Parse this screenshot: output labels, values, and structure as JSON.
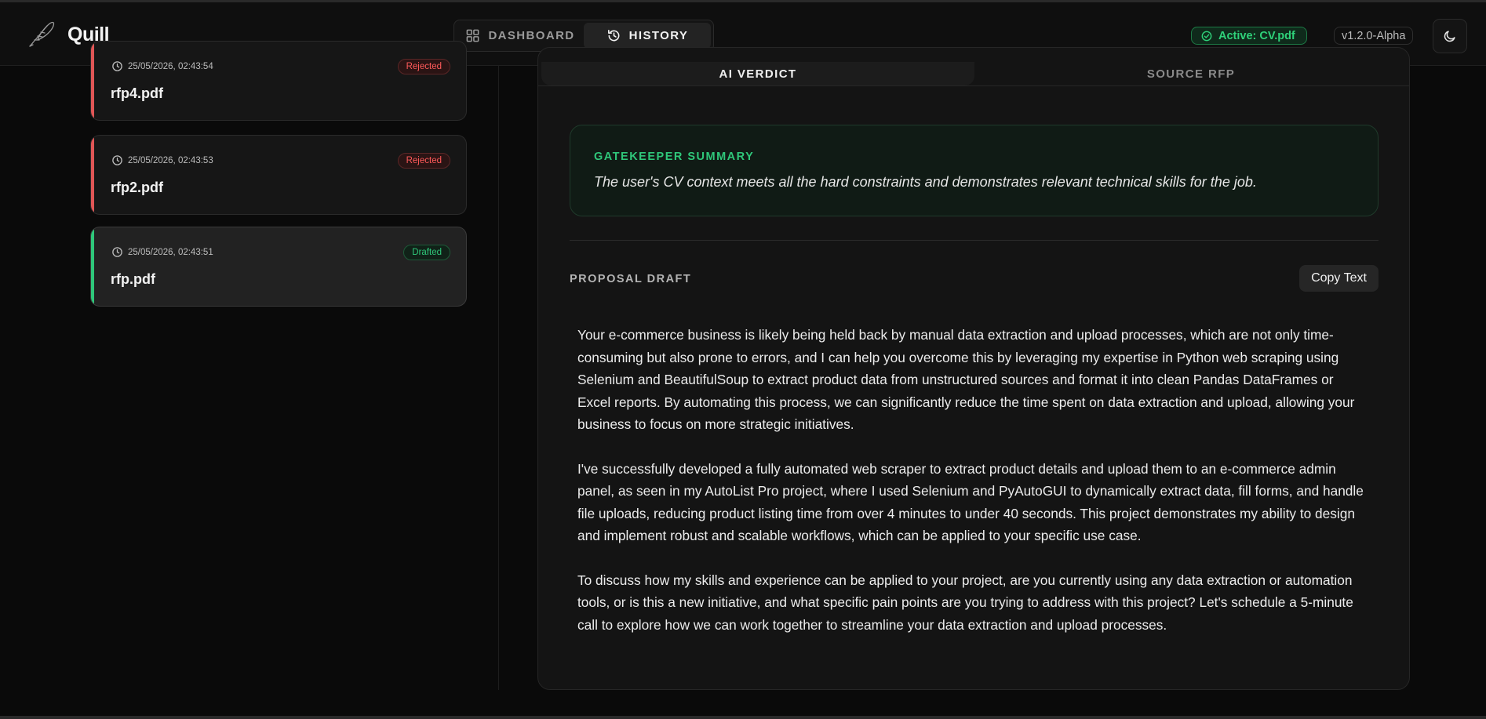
{
  "header": {
    "app_name": "Quill",
    "nav": [
      {
        "label": "DASHBOARD",
        "icon": "dashboard-grid-icon",
        "active": false
      },
      {
        "label": "HISTORY",
        "icon": "history-clock-icon",
        "active": true
      }
    ],
    "active_file": "Active: CV.pdf",
    "version": "v1.2.0-Alpha",
    "theme_icon": "moon-icon"
  },
  "history": [
    {
      "timestamp": "25/05/2026, 02:43:54",
      "filename": "rfp4.pdf",
      "status": "Rejected"
    },
    {
      "timestamp": "25/05/2026, 02:43:53",
      "filename": "rfp2.pdf",
      "status": "Rejected"
    },
    {
      "timestamp": "25/05/2026, 02:43:51",
      "filename": "rfp.pdf",
      "status": "Drafted"
    }
  ],
  "detail": {
    "tabs": [
      "AI VERDICT",
      "SOURCE RFP"
    ],
    "summary": {
      "title": "GATEKEEPER SUMMARY",
      "text": "The user's CV context meets all the hard constraints and demonstrates relevant technical skills for the job."
    },
    "draft": {
      "title": "PROPOSAL DRAFT",
      "copy_label": "Copy Text",
      "paragraphs": [
        "Your e-commerce business is likely being held back by manual data extraction and upload processes, which are not only time-consuming but also prone to errors, and I can help you overcome this by leveraging my expertise in Python web scraping using Selenium and BeautifulSoup to extract product data from unstructured sources and format it into clean Pandas DataFrames or Excel reports. By automating this process, we can significantly reduce the time spent on data extraction and upload, allowing your business to focus on more strategic initiatives.",
        "I've successfully developed a fully automated web scraper to extract product details and upload them to an e-commerce admin panel, as seen in my AutoList Pro project, where I used Selenium and PyAutoGUI to dynamically extract data, fill forms, and handle file uploads, reducing product listing time from over 4 minutes to under 40 seconds. This project demonstrates my ability to design and implement robust and scalable workflows, which can be applied to your specific use case.",
        "To discuss how my skills and experience can be applied to your project, are you currently using any data extraction or automation tools, or is this a new initiative, and what specific pain points are you trying to address with this project? Let's schedule a 5-minute call to explore how we can work together to streamline your data extraction and upload processes."
      ]
    }
  },
  "colors": {
    "accent_green": "#2fc77a",
    "reject_red": "#ff5a5a",
    "background": "#0a0a0a"
  }
}
